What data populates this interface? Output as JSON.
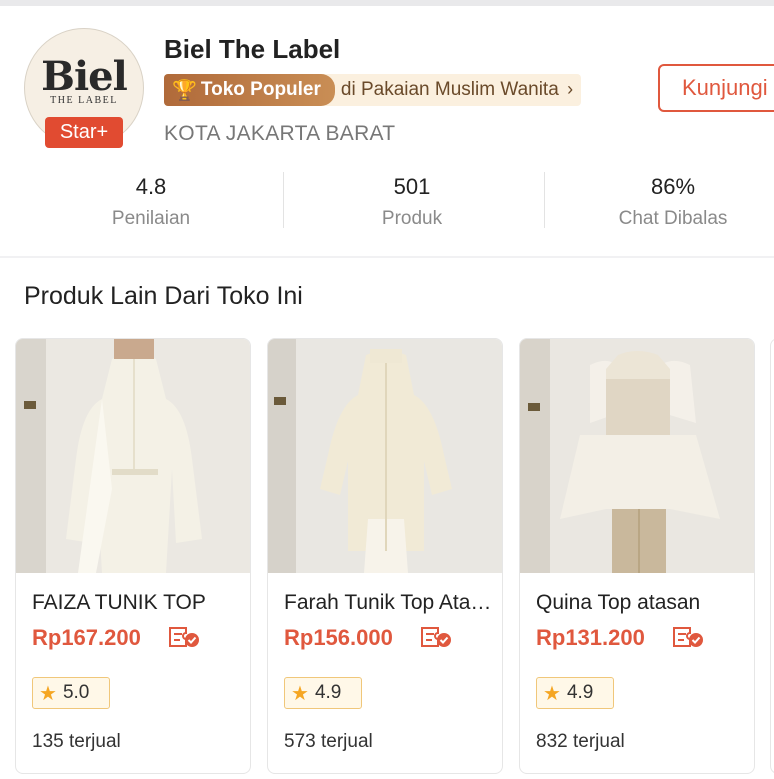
{
  "shop": {
    "logo_text": "Biel",
    "logo_subtext": "THE LABEL",
    "tier_badge": "Star+",
    "name": "Biel The Label",
    "popular_badge": "Toko Populer",
    "category_text": "di Pakaian Muslim Wanita",
    "city": "KOTA JAKARTA BARAT",
    "visit_label": "Kunjungi",
    "stats": [
      {
        "value": "4.8",
        "label": "Penilaian"
      },
      {
        "value": "501",
        "label": "Produk"
      },
      {
        "value": "86%",
        "label": "Chat Dibalas"
      }
    ]
  },
  "others": {
    "title": "Produk Lain Dari Toko Ini",
    "products": [
      {
        "name": "FAIZA TUNIK TOP",
        "price": "Rp167.200",
        "rating": "5.0",
        "sold": "135 terjual"
      },
      {
        "name": "Farah Tunik Top Atasan",
        "price": "Rp156.000",
        "rating": "4.9",
        "sold": "573 terjual"
      },
      {
        "name": "Quina Top atasan",
        "price": "Rp131.200",
        "rating": "4.9",
        "sold": "832 terjual"
      }
    ]
  },
  "colors": {
    "accent": "#e0583e",
    "badge_gold": "#b06a3a",
    "star": "#f5a623"
  }
}
